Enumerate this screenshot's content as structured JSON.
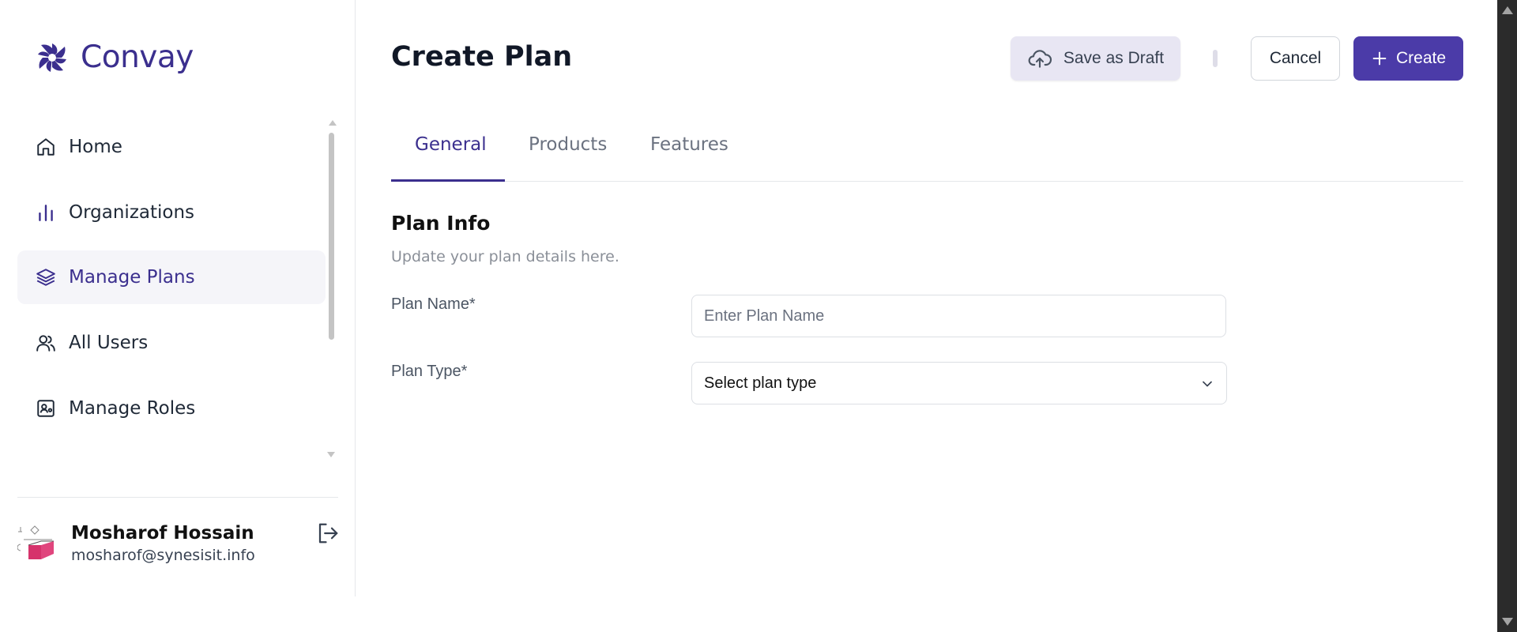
{
  "brand": {
    "name": "Convay",
    "accent": "#3b2f8e"
  },
  "sidebar": {
    "items": [
      {
        "label": "Home",
        "icon": "home-icon",
        "active": false
      },
      {
        "label": "Organizations",
        "icon": "bar-chart-icon",
        "active": false
      },
      {
        "label": "Manage Plans",
        "icon": "layers-icon",
        "active": true
      },
      {
        "label": "All Users",
        "icon": "users-icon",
        "active": false
      },
      {
        "label": "Manage Roles",
        "icon": "id-card-icon",
        "active": false
      }
    ]
  },
  "user": {
    "name": "Mosharof Hossain",
    "email": "mosharof@synesisit.info"
  },
  "header": {
    "title": "Create Plan",
    "draft_label": "Save as Draft",
    "cancel_label": "Cancel",
    "create_label": "Create",
    "create_color": "#4b3ba8"
  },
  "tabs": [
    {
      "label": "General",
      "active": true
    },
    {
      "label": "Products",
      "active": false
    },
    {
      "label": "Features",
      "active": false
    }
  ],
  "section": {
    "title": "Plan Info",
    "subtitle": "Update your plan details here."
  },
  "form": {
    "plan_name": {
      "label": "Plan Name*",
      "placeholder": "Enter Plan Name",
      "value": ""
    },
    "plan_type": {
      "label": "Plan Type*",
      "value": "Select plan type"
    }
  }
}
